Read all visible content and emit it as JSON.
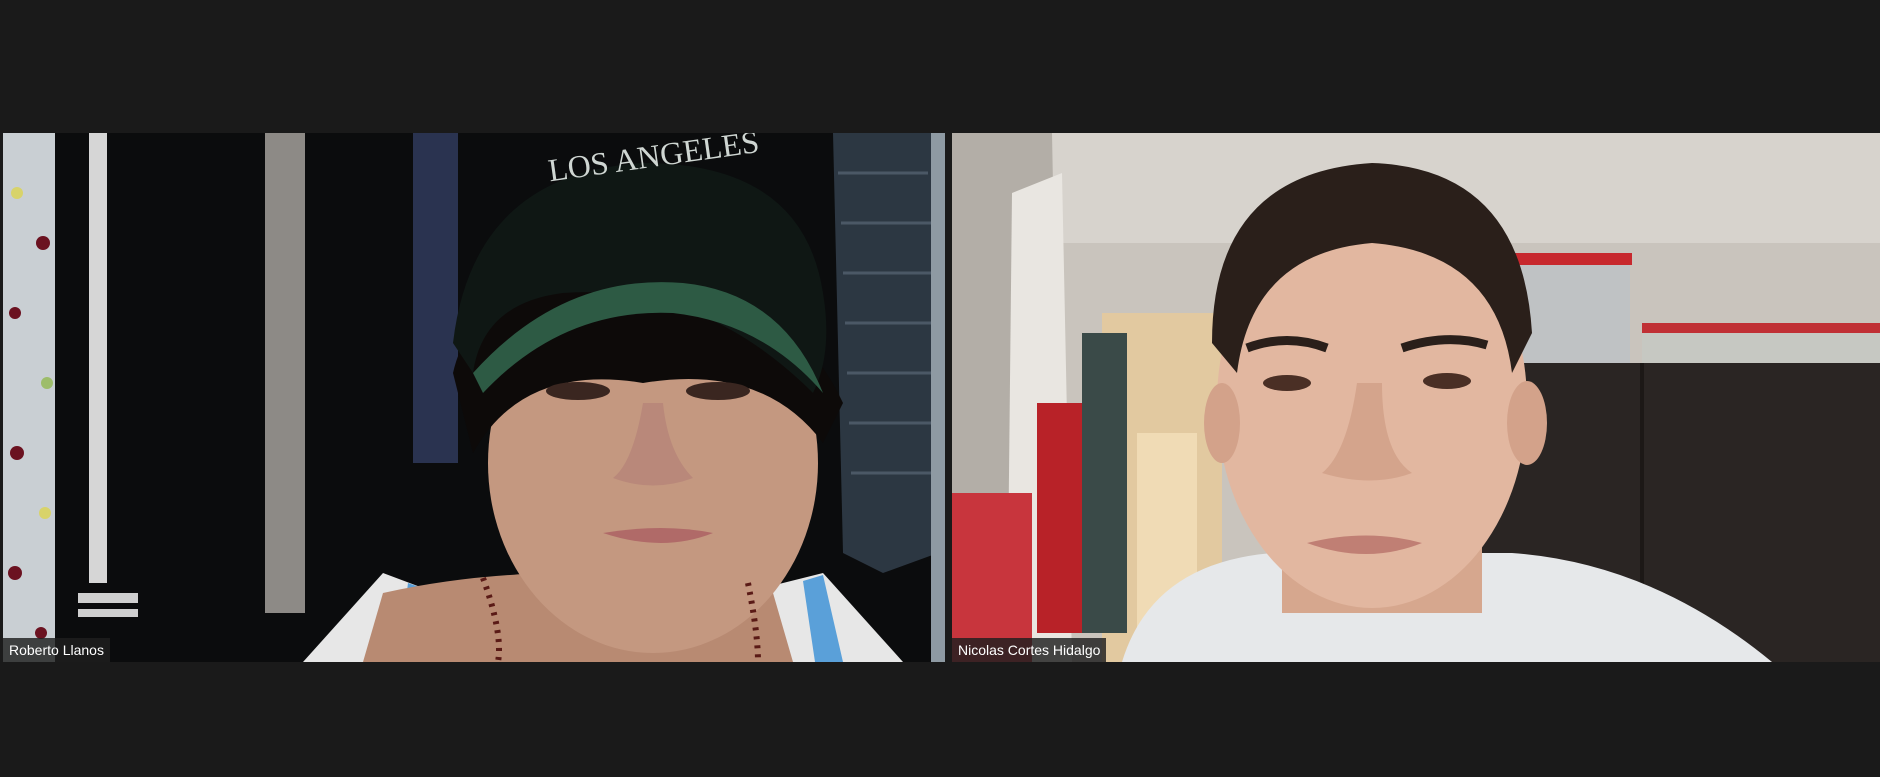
{
  "participants": [
    {
      "name": "Roberto Llanos"
    },
    {
      "name": "Nicolas Cortes Hidalgo"
    }
  ],
  "colors": {
    "background": "#1a1a1a",
    "label_background": "#1e1e1e",
    "label_text": "#ffffff"
  }
}
